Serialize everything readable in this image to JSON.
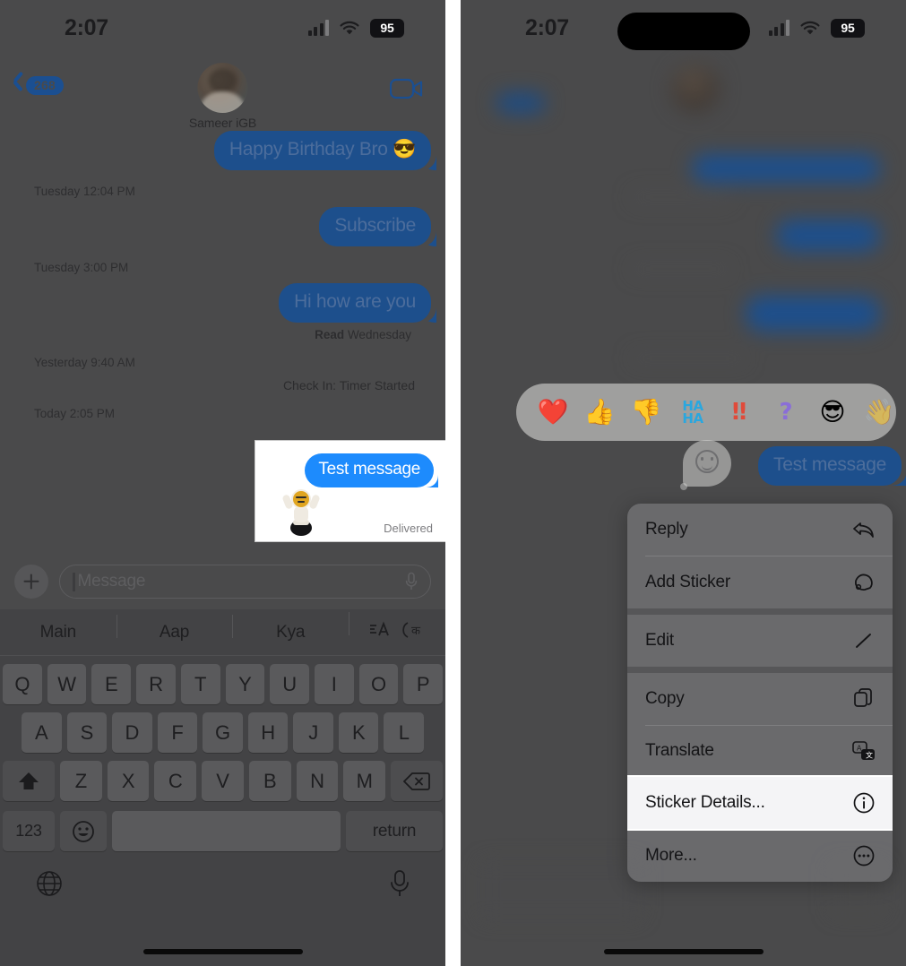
{
  "status_bar": {
    "time": "2:07",
    "battery": "95",
    "icons": [
      "cellular-signal-icon",
      "wifi-icon",
      "battery-icon"
    ]
  },
  "left_panel": {
    "nav": {
      "back_badge": "268",
      "contact_name": "Sameer iGB",
      "video_call_icon": "video-camera-icon"
    },
    "conversation": [
      {
        "type": "bubble",
        "text": "Happy Birthday Bro  😎",
        "side": "out",
        "clipped": true
      },
      {
        "type": "timestamp",
        "text": "Tuesday 12:04 PM"
      },
      {
        "type": "bubble",
        "text": "Subscribe",
        "side": "out"
      },
      {
        "type": "timestamp",
        "text": "Tuesday 3:00 PM"
      },
      {
        "type": "bubble",
        "text": "Hi how are you",
        "side": "out"
      },
      {
        "type": "receipt",
        "bold": "Read",
        "rest": " Wednesday"
      },
      {
        "type": "timestamp",
        "text": "Yesterday 9:40 AM"
      },
      {
        "type": "system",
        "text": "Check In: Timer Started"
      },
      {
        "type": "timestamp",
        "text": "Today 2:05 PM"
      }
    ],
    "callout": {
      "bubble_text": "Test message",
      "receipt": "Delivered",
      "sticker_name": "astronaut-sticker"
    },
    "input_bar": {
      "add_icon": "plus-icon",
      "placeholder": "Message",
      "mic_icon": "microphone-icon"
    },
    "keyboard": {
      "predictions": [
        "Main",
        "Aap",
        "Kya"
      ],
      "tool_icons": [
        "text-format-icon",
        "hindi-keyboard-icon"
      ],
      "row1": [
        "Q",
        "W",
        "E",
        "R",
        "T",
        "Y",
        "U",
        "I",
        "O",
        "P"
      ],
      "row2": [
        "A",
        "S",
        "D",
        "F",
        "G",
        "H",
        "J",
        "K",
        "L"
      ],
      "row3_shift": "shift-icon",
      "row3": [
        "Z",
        "X",
        "C",
        "V",
        "B",
        "N",
        "M"
      ],
      "row3_delete": "delete-icon",
      "numbers_key": "123",
      "emoji_key": "emoji-icon",
      "space_key": "",
      "return_key": "return",
      "globe_icon": "globe-icon",
      "dictation_icon": "microphone-icon"
    }
  },
  "right_panel": {
    "tapbacks": [
      {
        "name": "heart-reaction",
        "glyph": "❤️"
      },
      {
        "name": "thumbs-up-reaction",
        "glyph": "👍"
      },
      {
        "name": "thumbs-down-reaction",
        "glyph": "👎"
      },
      {
        "name": "haha-reaction",
        "glyph": "HA\nHA"
      },
      {
        "name": "exclamation-reaction",
        "glyph": "‼"
      },
      {
        "name": "question-reaction",
        "glyph": "?"
      },
      {
        "name": "emoji-reaction",
        "glyph": "😎"
      },
      {
        "name": "more-reactions",
        "glyph": "👋"
      }
    ],
    "bubble_text": "Test message",
    "sticker_chip_icon": "sticker-smiley-icon",
    "context_menu": [
      {
        "label": "Reply",
        "icon": "reply-arrow-icon",
        "selected": false,
        "separator_after": false
      },
      {
        "label": "Add Sticker",
        "icon": "sticker-icon",
        "selected": false,
        "separator_after": true
      },
      {
        "label": "Edit",
        "icon": "pencil-icon",
        "selected": false,
        "separator_after": true
      },
      {
        "label": "Copy",
        "icon": "copy-icon",
        "selected": false,
        "separator_after": false
      },
      {
        "label": "Translate",
        "icon": "translate-icon",
        "selected": false,
        "separator_after": false
      },
      {
        "label": "Sticker Details...",
        "icon": "info-circle-icon",
        "selected": true,
        "separator_after": false
      },
      {
        "label": "More...",
        "icon": "ellipsis-circle-icon",
        "selected": false,
        "separator_after": false
      }
    ]
  },
  "colors": {
    "dim_overlay": "#4a4a4b",
    "imessage_blue": "#1d8bfd",
    "dim_bubble_blue": "#1d4f8c",
    "selected_row": "#f4f4f6",
    "accent_blue": "#1b4f91"
  }
}
